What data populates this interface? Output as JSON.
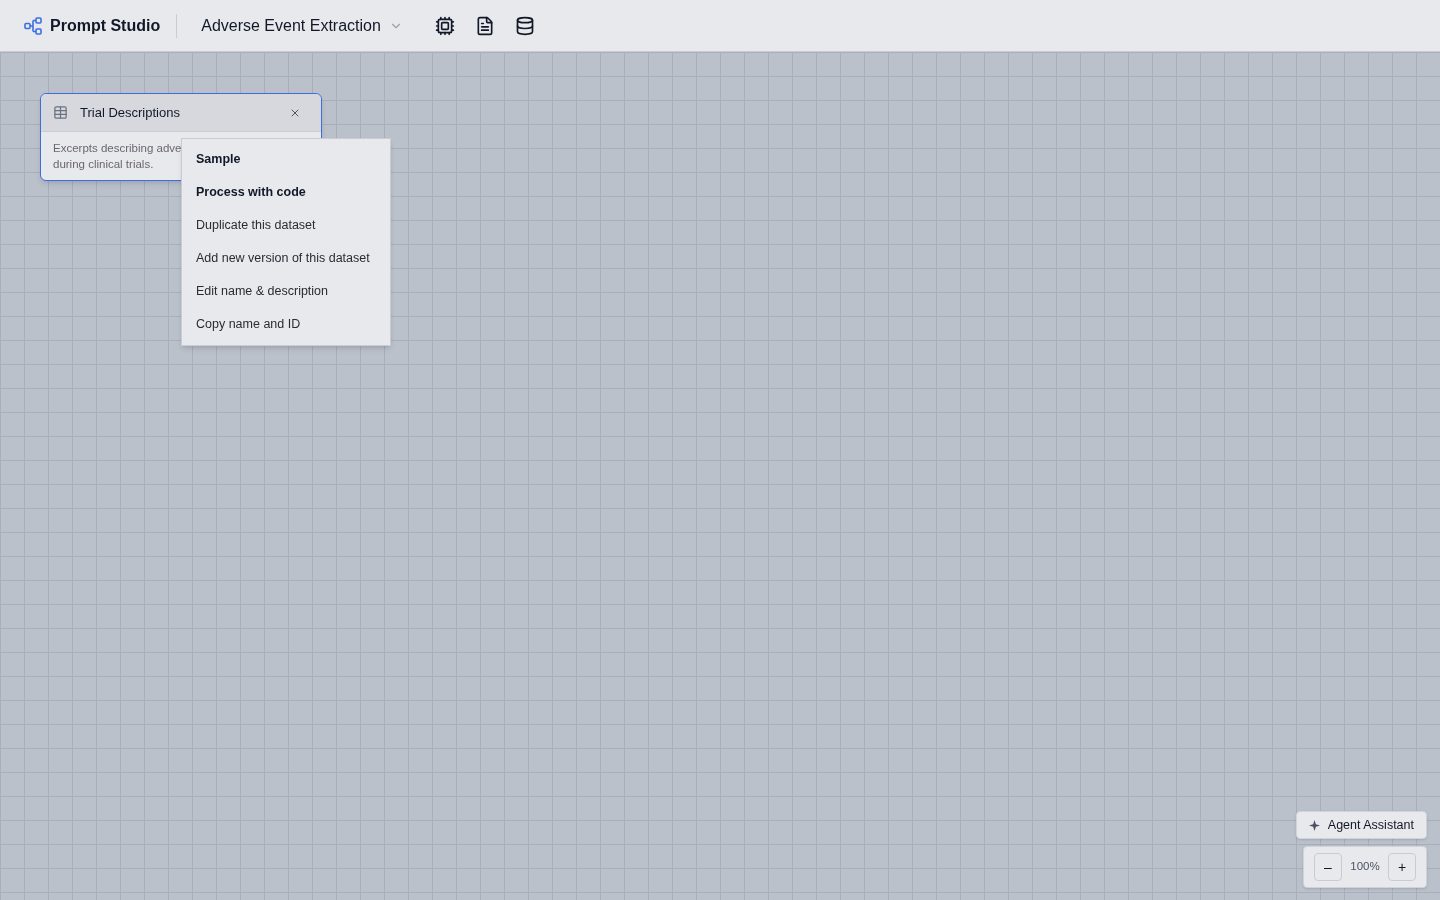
{
  "header": {
    "app_name": "Prompt Studio",
    "project": "Adverse Event Extraction"
  },
  "node": {
    "title": "Trial Descriptions",
    "description_lines": [
      "Excerpts describing adve",
      "during clinical trials."
    ],
    "selected": true
  },
  "context_menu": [
    {
      "label": "Sample",
      "emphasized": true
    },
    {
      "label": "Process with code",
      "emphasized": true
    },
    {
      "label": "Duplicate this dataset",
      "emphasized": false
    },
    {
      "label": "Add new version of this dataset",
      "emphasized": false
    },
    {
      "label": "Edit name & description",
      "emphasized": false
    },
    {
      "label": "Copy name and ID",
      "emphasized": false
    }
  ],
  "assistant_button": "Agent Assistant",
  "zoom": {
    "decrease": "–",
    "value": "100%",
    "increase": "+"
  }
}
